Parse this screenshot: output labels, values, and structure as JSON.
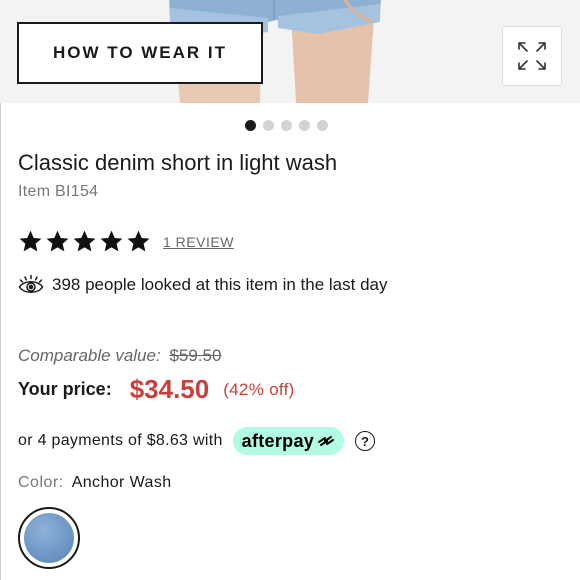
{
  "hero": {
    "how_to_wear_label": "HOW TO WEAR IT",
    "expand_icon": "expand-arrows-icon"
  },
  "carousel": {
    "count": 5,
    "active": 1
  },
  "product": {
    "title": "Classic denim short in light wash",
    "item_number": "Item BI154",
    "rating": 5,
    "reviews_label": "1 REVIEW",
    "views_text": "398 people looked at this item in the last day",
    "views_icon": "eye-icon"
  },
  "pricing": {
    "comparable_label": "Comparable value:",
    "comparable_value": "$59.50",
    "your_price_label": "Your price:",
    "price": "$34.50",
    "discount": "(42% off)",
    "accent_color": "#c9403a"
  },
  "afterpay": {
    "text": "or 4 payments of $8.63 with",
    "brand": "afterpay",
    "badge_color": "#b2fce4",
    "help_icon": "help-circle-icon"
  },
  "color": {
    "label": "Color:",
    "value": "Anchor Wash"
  }
}
